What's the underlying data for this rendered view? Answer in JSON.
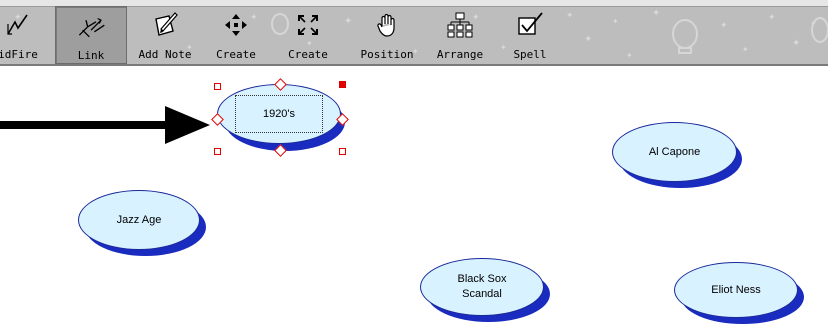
{
  "toolbar": {
    "tools": [
      {
        "id": "rapidfire",
        "label": "idFire",
        "icon": "rapidfire-icon"
      },
      {
        "id": "link",
        "label": "Link",
        "icon": "link-icon",
        "selected": true
      },
      {
        "id": "add-note",
        "label": "Add Note",
        "icon": "add-note-icon"
      },
      {
        "id": "create-1",
        "label": "Create",
        "icon": "move-arrows-icon"
      },
      {
        "id": "create-2",
        "label": "Create",
        "icon": "expand-arrows-icon"
      },
      {
        "id": "position",
        "label": "Position",
        "icon": "hand-icon"
      },
      {
        "id": "arrange",
        "label": "Arrange",
        "icon": "hierarchy-icon"
      },
      {
        "id": "spell",
        "label": "Spell",
        "icon": "spell-check-icon"
      }
    ]
  },
  "diagram": {
    "nodes": [
      {
        "id": "n1920s",
        "label": "1920's",
        "selected": true
      },
      {
        "id": "ncapone",
        "label": "Al Capone"
      },
      {
        "id": "njazz",
        "label": "Jazz Age"
      },
      {
        "id": "nsox",
        "label": "Black Sox\nScandal"
      },
      {
        "id": "nness",
        "label": "Eliot Ness"
      }
    ]
  },
  "colors": {
    "toolbar_bg": "#bdbdbd",
    "node_fill": "#d8f2ff",
    "node_shadow": "#1a2bbf",
    "selection_handle": "#e00000",
    "pointer_arrow": "#000000"
  }
}
